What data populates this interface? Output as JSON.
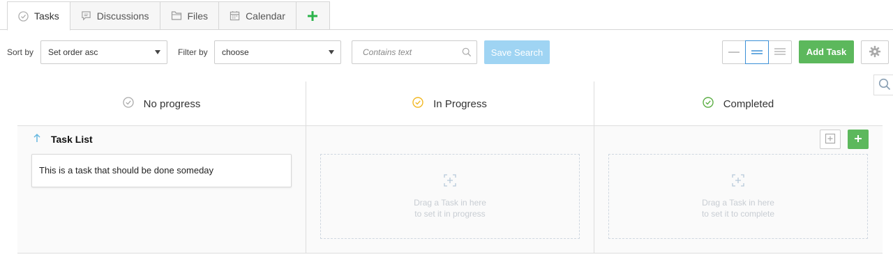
{
  "tabs": [
    {
      "label": "Tasks",
      "icon": "check-circle-icon",
      "active": true
    },
    {
      "label": "Discussions",
      "icon": "comment-icon"
    },
    {
      "label": "Files",
      "icon": "folder-icon"
    },
    {
      "label": "Calendar",
      "icon": "calendar-icon"
    }
  ],
  "toolbar": {
    "sort_label": "Sort by",
    "sort_value": "Set order asc",
    "filter_label": "Filter by",
    "filter_value": "choose",
    "search_placeholder": "Contains text",
    "save_search_label": "Save Search",
    "add_task_label": "Add Task"
  },
  "columns": [
    {
      "title": "No progress",
      "icon": "check-circle-icon",
      "color": "#aaaaaa"
    },
    {
      "title": "In Progress",
      "icon": "check-circle-icon",
      "color": "#f2b822"
    },
    {
      "title": "Completed",
      "icon": "check-circle-icon",
      "color": "#5cae44"
    }
  ],
  "task_list": {
    "title": "Task List",
    "tasks": [
      "This is a task that should be done someday"
    ]
  },
  "dropzones": {
    "in_progress": {
      "line1": "Drag a Task in here",
      "line2": "to set it in progress"
    },
    "completed": {
      "line1": "Drag a Task in here",
      "line2": "to set it to complete"
    }
  },
  "colors": {
    "accent_green": "#5cb85c",
    "accent_blue": "#3a8fd6",
    "save_search_bg": "#9fd4f3"
  }
}
